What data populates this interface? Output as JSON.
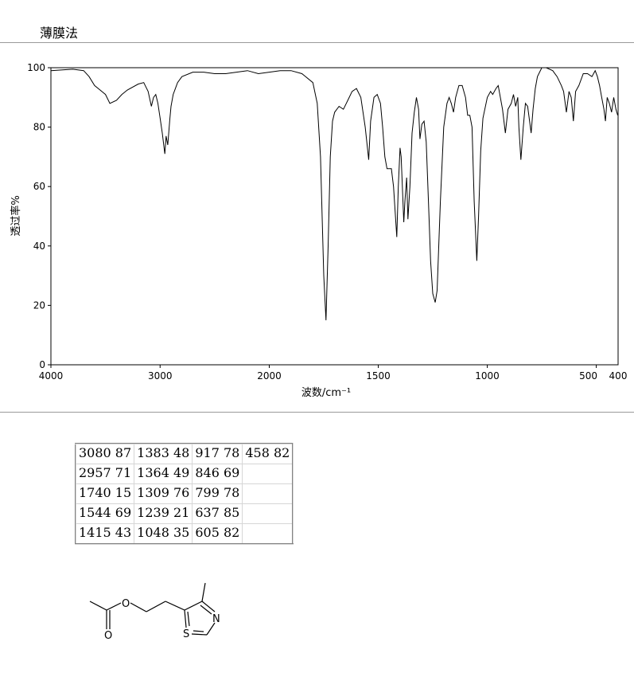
{
  "header": {
    "method": "薄膜法"
  },
  "chart_data": {
    "type": "line",
    "title": "",
    "xlabel": "波数/cm⁻¹",
    "ylabel": "透过率%",
    "xlim": [
      4000,
      400
    ],
    "ylim": [
      0,
      100
    ],
    "x_ticks": [
      4000,
      3000,
      2000,
      1500,
      1000,
      500
    ],
    "x_tick_labels": [
      "4000",
      "3000",
      "2000",
      "1500",
      "1000",
      "500"
    ],
    "x_end_label": "400",
    "y_ticks": [
      0,
      20,
      40,
      60,
      80,
      100
    ],
    "grid": false,
    "series": [
      {
        "values": [
          [
            4000,
            99
          ],
          [
            3800,
            99.5
          ],
          [
            3700,
            99
          ],
          [
            3650,
            97
          ],
          [
            3600,
            94
          ],
          [
            3550,
            92.5
          ],
          [
            3500,
            91
          ],
          [
            3460,
            88
          ],
          [
            3400,
            89
          ],
          [
            3350,
            91
          ],
          [
            3300,
            92.5
          ],
          [
            3200,
            94.5
          ],
          [
            3150,
            95
          ],
          [
            3110,
            92
          ],
          [
            3080,
            87
          ],
          [
            3060,
            90
          ],
          [
            3040,
            91
          ],
          [
            3020,
            88
          ],
          [
            3000,
            83
          ],
          [
            2980,
            78
          ],
          [
            2957,
            71
          ],
          [
            2945,
            77
          ],
          [
            2930,
            74
          ],
          [
            2910,
            83
          ],
          [
            2900,
            87
          ],
          [
            2880,
            91
          ],
          [
            2860,
            93
          ],
          [
            2840,
            95
          ],
          [
            2800,
            97
          ],
          [
            2700,
            98.5
          ],
          [
            2600,
            98.5
          ],
          [
            2500,
            98
          ],
          [
            2400,
            98
          ],
          [
            2300,
            98.5
          ],
          [
            2200,
            99
          ],
          [
            2100,
            98
          ],
          [
            2000,
            98.5
          ],
          [
            1950,
            99
          ],
          [
            1900,
            99
          ],
          [
            1850,
            98
          ],
          [
            1800,
            95
          ],
          [
            1780,
            88
          ],
          [
            1765,
            70
          ],
          [
            1750,
            30
          ],
          [
            1740,
            15
          ],
          [
            1730,
            40
          ],
          [
            1720,
            70
          ],
          [
            1710,
            82
          ],
          [
            1700,
            85
          ],
          [
            1680,
            87
          ],
          [
            1660,
            86
          ],
          [
            1640,
            89
          ],
          [
            1620,
            92
          ],
          [
            1600,
            93
          ],
          [
            1580,
            90
          ],
          [
            1560,
            80
          ],
          [
            1544,
            69
          ],
          [
            1535,
            82
          ],
          [
            1520,
            90
          ],
          [
            1505,
            91
          ],
          [
            1490,
            88
          ],
          [
            1480,
            80
          ],
          [
            1470,
            70
          ],
          [
            1460,
            66
          ],
          [
            1440,
            66
          ],
          [
            1430,
            60
          ],
          [
            1415,
            43
          ],
          [
            1408,
            60
          ],
          [
            1400,
            73
          ],
          [
            1395,
            70
          ],
          [
            1383,
            48
          ],
          [
            1378,
            55
          ],
          [
            1370,
            63
          ],
          [
            1364,
            49
          ],
          [
            1355,
            60
          ],
          [
            1345,
            78
          ],
          [
            1335,
            85
          ],
          [
            1325,
            90
          ],
          [
            1315,
            86
          ],
          [
            1309,
            76
          ],
          [
            1300,
            81
          ],
          [
            1290,
            82
          ],
          [
            1280,
            75
          ],
          [
            1270,
            55
          ],
          [
            1260,
            35
          ],
          [
            1250,
            24
          ],
          [
            1239,
            21
          ],
          [
            1230,
            25
          ],
          [
            1215,
            55
          ],
          [
            1200,
            80
          ],
          [
            1185,
            88
          ],
          [
            1175,
            90
          ],
          [
            1165,
            88
          ],
          [
            1155,
            85
          ],
          [
            1145,
            90
          ],
          [
            1130,
            94
          ],
          [
            1115,
            94
          ],
          [
            1100,
            90
          ],
          [
            1090,
            84
          ],
          [
            1080,
            84
          ],
          [
            1070,
            80
          ],
          [
            1060,
            55
          ],
          [
            1048,
            35
          ],
          [
            1040,
            50
          ],
          [
            1030,
            72
          ],
          [
            1020,
            83
          ],
          [
            1000,
            90
          ],
          [
            985,
            92
          ],
          [
            975,
            91
          ],
          [
            960,
            93
          ],
          [
            950,
            94
          ],
          [
            940,
            90
          ],
          [
            930,
            86
          ],
          [
            917,
            78
          ],
          [
            905,
            86
          ],
          [
            890,
            88
          ],
          [
            880,
            91
          ],
          [
            870,
            87
          ],
          [
            860,
            90
          ],
          [
            855,
            80
          ],
          [
            846,
            69
          ],
          [
            835,
            80
          ],
          [
            825,
            88
          ],
          [
            815,
            87
          ],
          [
            799,
            78
          ],
          [
            790,
            86
          ],
          [
            780,
            93
          ],
          [
            770,
            97
          ],
          [
            750,
            100
          ],
          [
            730,
            100
          ],
          [
            700,
            99
          ],
          [
            680,
            97
          ],
          [
            660,
            94
          ],
          [
            650,
            92
          ],
          [
            637,
            85
          ],
          [
            625,
            92
          ],
          [
            615,
            90
          ],
          [
            605,
            82
          ],
          [
            595,
            92
          ],
          [
            580,
            94
          ],
          [
            560,
            98
          ],
          [
            540,
            98
          ],
          [
            520,
            97
          ],
          [
            505,
            99
          ],
          [
            495,
            97
          ],
          [
            485,
            94
          ],
          [
            475,
            90
          ],
          [
            465,
            86
          ],
          [
            458,
            82
          ],
          [
            450,
            90
          ],
          [
            440,
            88
          ],
          [
            430,
            85
          ],
          [
            420,
            90
          ],
          [
            410,
            86
          ],
          [
            402,
            84
          ]
        ]
      }
    ]
  },
  "peak_table": {
    "rows": [
      [
        "3080 87",
        "1383 48",
        "917 78",
        "458 82"
      ],
      [
        "2957 71",
        "1364 49",
        "846 69",
        ""
      ],
      [
        "1740 15",
        "1309 76",
        "799 78",
        ""
      ],
      [
        "1544 69",
        "1239 21",
        "637 85",
        ""
      ],
      [
        "1415 43",
        "1048 35",
        "605 82",
        ""
      ]
    ]
  },
  "structure": {
    "atom_labels": [
      "O",
      "O",
      "S",
      "N"
    ]
  }
}
